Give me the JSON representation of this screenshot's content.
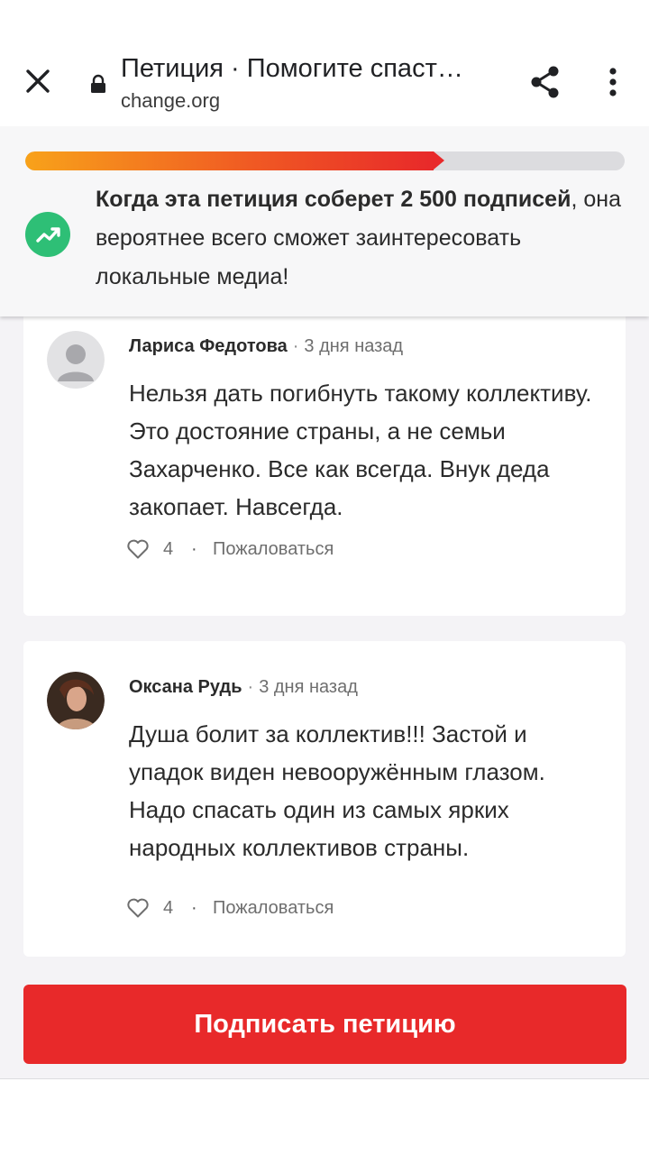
{
  "browser": {
    "title": "Петиция · Помогите спаст…",
    "url": "change.org"
  },
  "progress": {
    "fraction": 0.7,
    "milestone_bold": "Когда эта петиция соберет 2 500 подписей",
    "milestone_rest": ", она вероятнее всего сможет заинтересовать локальные медиа!",
    "accent_color": "#e8292a",
    "icon_color": "#2ebf76"
  },
  "comments": [
    {
      "author": "Лариса Федотова",
      "sep": "·",
      "time": "3 дня назад",
      "text": "Нельзя дать погибнуть такому коллективу. Это достояние страны, а не семьи Захарченко. Все как всегда. Внук деда закопает. Навсегда.",
      "likes": "4",
      "dot": "·",
      "report": "Пожаловаться",
      "avatar": "default-avatar-icon"
    },
    {
      "author": "Оксана Рудь",
      "sep": "·",
      "time": "3 дня назад",
      "text": "Душа болит за коллектив!!! Застой и упадок виден невооружённым глазом. Надо спасать один из самых ярких народных коллективов страны.",
      "likes": "4",
      "dot": "·",
      "report": "Пожаловаться",
      "avatar": "user-photo"
    }
  ],
  "sign_button": "Подписать петицию"
}
